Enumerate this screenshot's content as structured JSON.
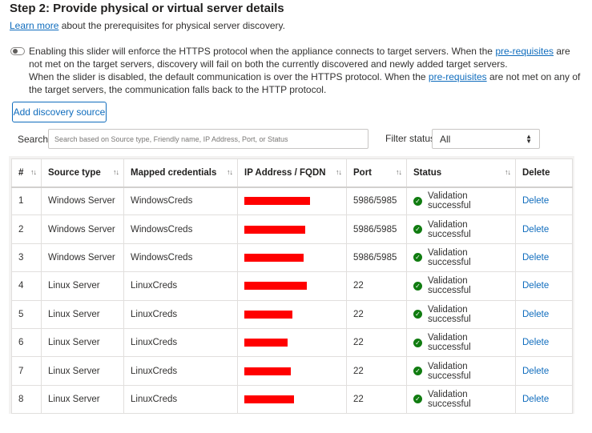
{
  "header": {
    "title": "Step 2: Provide physical or virtual server details",
    "learn_more": "Learn more",
    "learn_more_suffix": " about the prerequisites for physical server discovery."
  },
  "toggle": {
    "state": "off"
  },
  "description": {
    "p1_a": "Enabling this slider will enforce the HTTPS protocol when the appliance connects to target servers. When the ",
    "p1_link": "pre-requisites",
    "p1_b": " are not met on the target servers, discovery will fail on both the currently discovered and newly added target servers.",
    "p2_a": "When the slider is disabled, the default communication is over the HTTPS protocol. When the ",
    "p2_link": "pre-requisites",
    "p2_b": " are not met on any of the target servers, the communication falls back to the HTTP protocol."
  },
  "toolbar": {
    "add_source": "Add discovery source",
    "search_label": "Search:",
    "search_placeholder": "Search based on Source type, Friendly name, IP Address, Port, or Status",
    "filter_label": "Filter status",
    "filter_value": "All"
  },
  "table": {
    "columns": [
      "#",
      "Source type",
      "Mapped credentials",
      "IP Address / FQDN",
      "Port",
      "Status",
      "Delete"
    ],
    "rows": [
      {
        "num": "1",
        "source": "Windows Server",
        "cred": "WindowsCreds",
        "port": "5986/5985",
        "status": "Validation successful",
        "action": "Delete"
      },
      {
        "num": "2",
        "source": "Windows Server",
        "cred": "WindowsCreds",
        "port": "5986/5985",
        "status": "Validation successful",
        "action": "Delete"
      },
      {
        "num": "3",
        "source": "Windows Server",
        "cred": "WindowsCreds",
        "port": "5986/5985",
        "status": "Validation successful",
        "action": "Delete"
      },
      {
        "num": "4",
        "source": "Linux Server",
        "cred": "LinuxCreds",
        "port": "22",
        "status": "Validation successful",
        "action": "Delete"
      },
      {
        "num": "5",
        "source": "Linux Server",
        "cred": "LinuxCreds",
        "port": "22",
        "status": "Validation successful",
        "action": "Delete"
      },
      {
        "num": "6",
        "source": "Linux Server",
        "cred": "LinuxCreds",
        "port": "22",
        "status": "Validation successful",
        "action": "Delete"
      },
      {
        "num": "7",
        "source": "Linux Server",
        "cred": "LinuxCreds",
        "port": "22",
        "status": "Validation successful",
        "action": "Delete"
      },
      {
        "num": "8",
        "source": "Linux Server",
        "cred": "LinuxCreds",
        "port": "22",
        "status": "Validation successful",
        "action": "Delete"
      }
    ]
  },
  "colors": {
    "link": "#0f6cbd",
    "success": "#107c10",
    "redaction": "#ff0000"
  },
  "icons": {
    "sort": "sort-arrows-icon",
    "status": "check-circle-icon",
    "select": "chevron-updown-icon",
    "toggle": "toggle-off-icon"
  }
}
